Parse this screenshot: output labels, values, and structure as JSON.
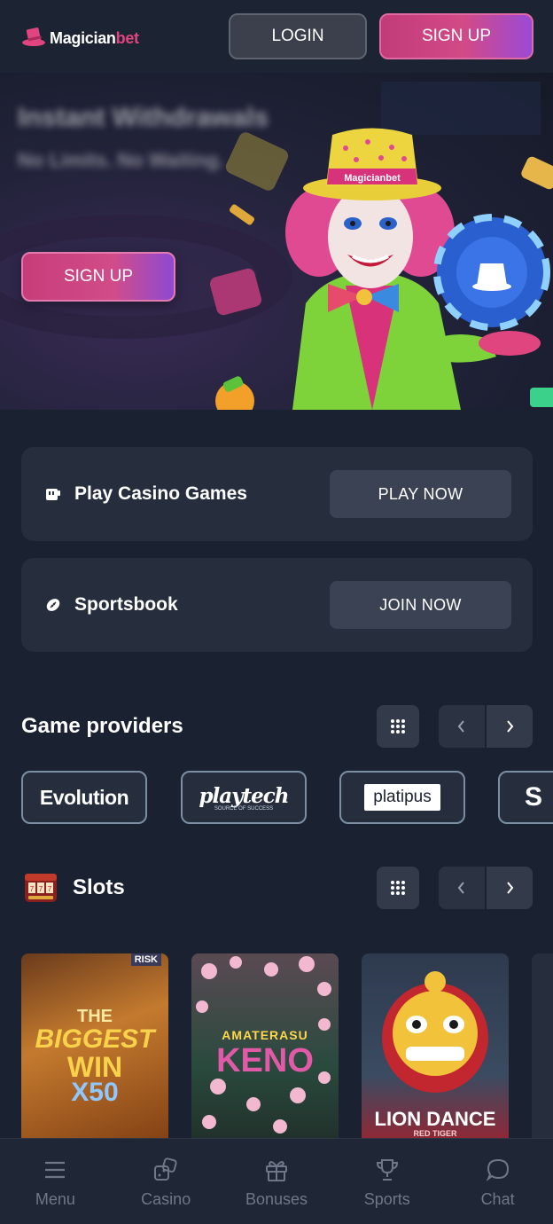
{
  "header": {
    "logo": {
      "text_main": "Magician",
      "text_accent": "bet"
    },
    "login_label": "LOGIN",
    "signup_label": "SIGN UP"
  },
  "hero": {
    "title_blurred": "Instant Withdrawals",
    "subtitle_blurred": "No Limits. No Waiting.",
    "signup_label": "SIGN UP",
    "hat_band_text": "Magicianbet"
  },
  "cards": [
    {
      "label": "Play Casino Games",
      "button": "PLAY NOW",
      "icon": "casino-icon"
    },
    {
      "label": "Sportsbook",
      "button": "JOIN NOW",
      "icon": "football-icon"
    }
  ],
  "providers_section": {
    "title": "Game providers",
    "providers": [
      {
        "name": "Evolution"
      },
      {
        "name": "playtech",
        "tagline": "SOURCE OF SUCCESS"
      },
      {
        "name": "platipus"
      },
      {
        "name": "S"
      }
    ]
  },
  "slots_section": {
    "title": "Slots",
    "games": [
      {
        "badge": "RISK",
        "line1": "THE",
        "line2": "BIGGEST",
        "line3": "WIN",
        "line4": "X50"
      },
      {
        "line1": "AMATERASU",
        "line2": "KENO"
      },
      {
        "line1": "LION DANCE",
        "line2": "RED TIGER"
      },
      {
        "line1": ""
      }
    ]
  },
  "bottom_nav": [
    {
      "label": "Menu",
      "icon": "menu-icon"
    },
    {
      "label": "Casino",
      "icon": "dice-icon"
    },
    {
      "label": "Bonuses",
      "icon": "gift-icon"
    },
    {
      "label": "Sports",
      "icon": "trophy-icon"
    },
    {
      "label": "Chat",
      "icon": "chat-icon"
    }
  ],
  "colors": {
    "background": "#1a2130",
    "card": "#262e3e",
    "accent_pink": "#d24a86",
    "accent_purple": "#9b4ad6",
    "muted_text": "#6f7788"
  }
}
